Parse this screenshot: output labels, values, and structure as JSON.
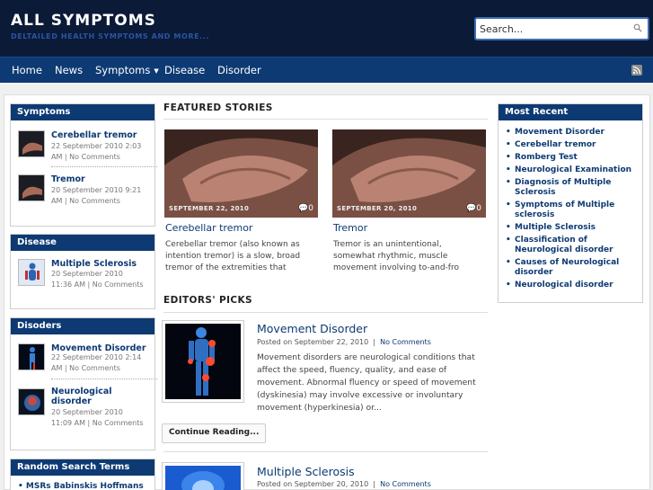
{
  "header": {
    "title": "ALL SYMPTOMS",
    "tagline": "DELTAILED HEALTH SYMPTOMS AND MORE...",
    "search_placeholder": "Search..."
  },
  "nav": {
    "items": [
      "Home",
      "News",
      "Symptoms",
      "Disease",
      "Disorder"
    ]
  },
  "widgets": {
    "symptoms": {
      "title": "Symptoms",
      "items": [
        {
          "title": "Cerebellar tremor",
          "meta1": "22 September 2010 2:03",
          "meta2": "AM | No Comments"
        },
        {
          "title": "Tremor",
          "meta1": "20 September 2010 9:21",
          "meta2": "AM | No Comments"
        }
      ]
    },
    "disease": {
      "title": "Disease",
      "items": [
        {
          "title": "Multiple Sclerosis",
          "meta1": "20 September 2010",
          "meta2": "11:36 AM | No Comments"
        }
      ]
    },
    "disoders": {
      "title": "Disoders",
      "items": [
        {
          "title": "Movement Disorder",
          "meta1": "22 September 2010 2:14",
          "meta2": "AM | No Comments"
        },
        {
          "title_line1": "Neurological",
          "title_line2": "disorder",
          "meta1": "20 September 2010",
          "meta2": "11:09 AM | No Comments"
        }
      ]
    },
    "random": {
      "title": "Random Search Terms",
      "first_item": "MSRs Babinskis Hoffmans"
    }
  },
  "featured": {
    "heading": "FEATURED STORIES",
    "stories": [
      {
        "date": "SEPTEMBER 22, 2010",
        "comments": "0",
        "title": "Cerebellar tremor",
        "excerpt": [
          "Cerebellar tremor (also known as",
          "intention tremor) is a slow, broad",
          "tremor of the extremities that"
        ]
      },
      {
        "date": "SEPTEMBER 20, 2010",
        "comments": "0",
        "title": "Tremor",
        "excerpt": [
          "Tremor is an unintentional,",
          "somewhat rhythmic, muscle",
          "movement involving to-and-fro"
        ]
      }
    ]
  },
  "editors": {
    "heading": "EDITORS' PICKS",
    "picks": [
      {
        "title": "Movement Disorder",
        "meta_prefix": "Posted on September 22, 2010",
        "meta_sep": "|",
        "comments": "No Comments",
        "text": [
          "Movement disorders are neurological conditions that",
          "affect the speed, fluency, quality, and ease of",
          "movement. Abnormal fluency or speed of movement",
          "(dyskinesia) may involve excessive or involuntary",
          "movement (hyperkinesia) or..."
        ],
        "button": "Continue Reading..."
      },
      {
        "title": "Multiple Sclerosis",
        "meta_prefix": "Posted on September 20, 2010",
        "meta_sep": "|",
        "comments": "No Comments"
      }
    ]
  },
  "recent": {
    "title": "Most Recent",
    "items": [
      "Movement Disorder",
      "Cerebellar tremor",
      "Romberg Test",
      "Neurological Examination",
      "Diagnosis of Multiple Sclerosis",
      "Symptoms of Multiple sclerosis",
      "Multiple Sclerosis",
      "Classification of Neurological disorder",
      "Causes of Neurological disorder",
      "Neurological disorder"
    ]
  },
  "colors": {
    "header_bg": "#0b1a36",
    "nav_bg": "#0d3a73",
    "link": "#0d3a73",
    "tagline": "#2a55a3"
  }
}
